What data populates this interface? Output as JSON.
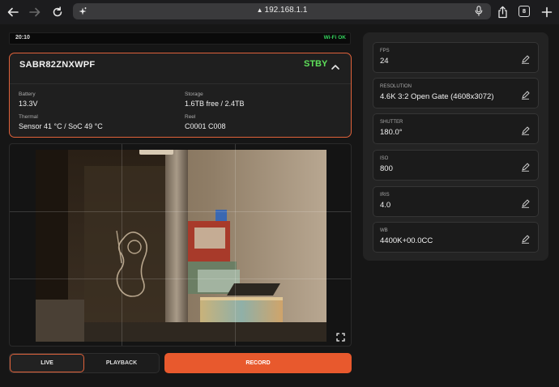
{
  "browser": {
    "url": "192.168.1.1",
    "tab_count": "8"
  },
  "status": {
    "time": "20:10",
    "wifi": "Wi-Fi OK"
  },
  "camera": {
    "name": "SABR82ZNXWPF",
    "state": "STBY",
    "fields": {
      "battery_label": "Battery",
      "battery_value": "13.3V",
      "storage_label": "Storage",
      "storage_value": "1.6TB free / 2.4TB",
      "thermal_label": "Thermal",
      "thermal_value": "Sensor 41 °C / SoC 49 °C",
      "reel_label": "Reel",
      "reel_value": "C0001 C008"
    }
  },
  "controls": {
    "live_label": "LIVE",
    "playback_label": "PLAYBACK",
    "record_label": "RECORD"
  },
  "settings": [
    {
      "label": "FPS",
      "value": "24"
    },
    {
      "label": "RESOLUTION",
      "value": "4.6K 3:2 Open Gate (4608x3072)"
    },
    {
      "label": "SHUTTER",
      "value": "180.0°"
    },
    {
      "label": "ISO",
      "value": "800"
    },
    {
      "label": "IRIS",
      "value": "4.0"
    },
    {
      "label": "WB",
      "value": "4400K+00.0CC"
    }
  ],
  "colors": {
    "accent": "#e8592d",
    "standby": "#5ee05a",
    "wifi_ok": "#33d15c"
  },
  "icons": [
    "back-icon",
    "forward-icon",
    "reload-icon",
    "sparkle-icon",
    "lock-icon",
    "microphone-icon",
    "share-icon",
    "tabs-icon",
    "add-tab-icon",
    "chevron-up-icon",
    "pencil-icon",
    "fullscreen-icon"
  ]
}
